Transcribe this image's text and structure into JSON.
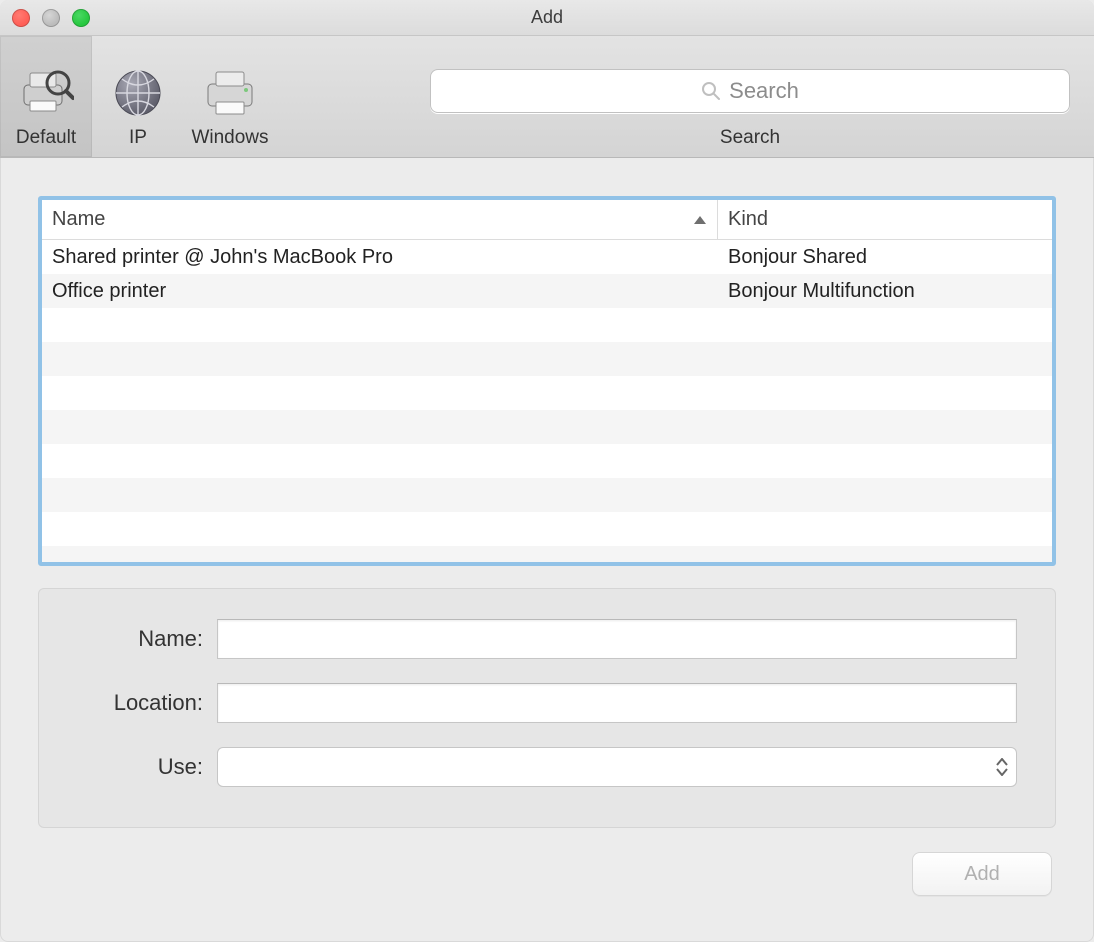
{
  "window": {
    "title": "Add"
  },
  "toolbar": {
    "items": [
      {
        "label": "Default",
        "selected": true
      },
      {
        "label": "IP",
        "selected": false
      },
      {
        "label": "Windows",
        "selected": false
      }
    ],
    "search": {
      "placeholder": "Search",
      "label": "Search",
      "value": ""
    }
  },
  "table": {
    "columns": {
      "name": "Name",
      "kind": "Kind"
    },
    "sort": {
      "column": "name",
      "direction": "asc"
    },
    "rows": [
      {
        "name": "Shared printer @ John's MacBook Pro",
        "kind": "Bonjour Shared"
      },
      {
        "name": "Office printer",
        "kind": "Bonjour Multifunction"
      }
    ]
  },
  "form": {
    "name": {
      "label": "Name:",
      "value": ""
    },
    "location": {
      "label": "Location:",
      "value": ""
    },
    "use": {
      "label": "Use:",
      "value": ""
    }
  },
  "footer": {
    "add_label": "Add",
    "add_enabled": false
  }
}
